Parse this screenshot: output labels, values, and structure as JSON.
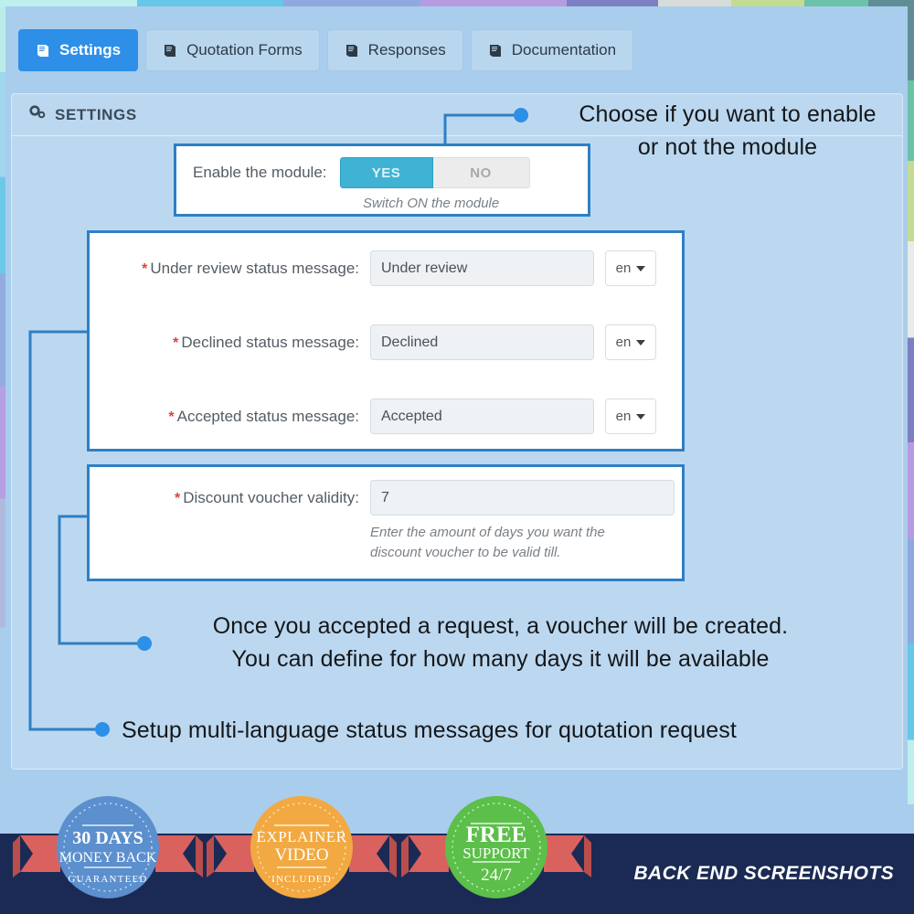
{
  "tabs": [
    {
      "label": "Settings",
      "icon": "book-icon",
      "active": true
    },
    {
      "label": "Quotation Forms",
      "icon": "book-icon",
      "active": false
    },
    {
      "label": "Responses",
      "icon": "book-icon",
      "active": false
    },
    {
      "label": "Documentation",
      "icon": "book-icon",
      "active": false
    }
  ],
  "panel": {
    "title": "SETTINGS",
    "icon": "gears-icon"
  },
  "enable_card": {
    "label": "Enable the module:",
    "toggle": {
      "on_label": "YES",
      "off_label": "NO",
      "selected": "YES"
    },
    "hint": "Switch ON the module"
  },
  "status_card": {
    "rows": [
      {
        "required": "*",
        "label": "Under review status message:",
        "value": "Under review",
        "lang": "en"
      },
      {
        "required": "*",
        "label": "Declined status message:",
        "value": "Declined",
        "lang": "en"
      },
      {
        "required": "*",
        "label": "Accepted status message:",
        "value": "Accepted",
        "lang": "en"
      }
    ]
  },
  "voucher_card": {
    "required": "*",
    "label": "Discount voucher validity:",
    "value": "7",
    "hint_line1": "Enter the amount of days you want the",
    "hint_line2": "discount voucher to be valid till."
  },
  "annotations": {
    "enable_line1": "Choose if you want to enable",
    "enable_line2": "or not the module",
    "voucher_line1": "Once you accepted a request, a voucher will be created.",
    "voucher_line2": "You can define for how many days it will be available",
    "lang_line1": "Setup multi-language status messages for quotation request"
  },
  "badges": [
    {
      "line1": "30 DAYS",
      "line2": "MONEY BACK",
      "line3": "GUARANTEED",
      "color": "#5b8fce"
    },
    {
      "line1": "EXPLAINER",
      "line2": "VIDEO",
      "line3": "INCLUDED",
      "color": "#f2a942"
    },
    {
      "line1": "FREE",
      "line2": "SUPPORT",
      "line3": "24/7",
      "color": "#5cbf4a"
    }
  ],
  "bottom_bar": {
    "label": "BACK END SCREENSHOTS",
    "background": "#1b2a54"
  },
  "colors": {
    "page_background": "#a9cdec",
    "active_tab": "#2d8fe8",
    "callout_stroke": "#2f7fc4",
    "toggle_on": "#40b3d4",
    "required_star": "#d9453c"
  }
}
